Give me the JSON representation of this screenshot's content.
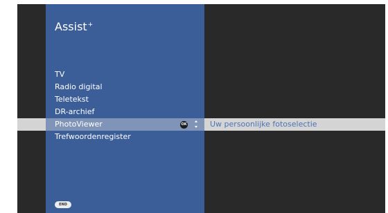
{
  "menu": {
    "title_main": "Assist",
    "title_sup": "+",
    "items": [
      {
        "label": "TV"
      },
      {
        "label": "Radio digital"
      },
      {
        "label": "Teletekst"
      },
      {
        "label": "DR-archief"
      },
      {
        "label": "PhotoViewer",
        "selected": true,
        "description": "Uw persoonlijke fotoselectie"
      },
      {
        "label": "Trefwoordenregister"
      }
    ],
    "ok_label": "OK",
    "end_label": "END"
  },
  "colors": {
    "background": "#292929",
    "panel": "#3c5e98",
    "selected_row": "#d4d4d4",
    "selected_label": "#7f94b7",
    "description_text": "#4c73b5"
  },
  "icons": {
    "ok": "ok-button-icon",
    "navigate": "up-down-arrows-icon",
    "end": "end-button-icon"
  }
}
